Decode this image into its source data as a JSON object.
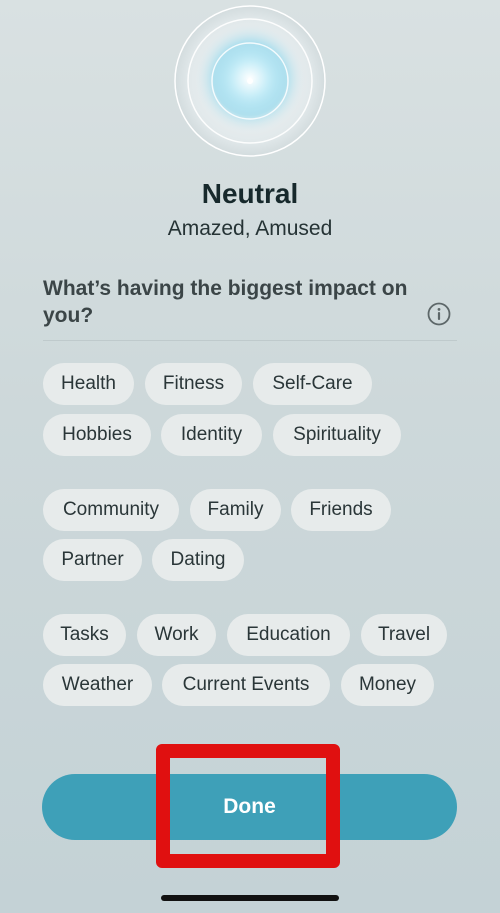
{
  "mood": {
    "title": "Neutral",
    "subtitle": "Amazed, Amused"
  },
  "question": "What’s having the biggest impact on you?",
  "info_icon": "info-circle-icon",
  "chip_groups": [
    [
      "Health",
      "Fitness",
      "Self-Care",
      "Hobbies",
      "Identity",
      "Spirituality"
    ],
    [
      "Community",
      "Family",
      "Friends",
      "Partner",
      "Dating"
    ],
    [
      "Tasks",
      "Work",
      "Education",
      "Travel",
      "Weather",
      "Current Events",
      "Money"
    ]
  ],
  "done_label": "Done",
  "colors": {
    "accent": "#3ea0b8",
    "chip_background": "#e7ebeb",
    "highlight": "#e01010"
  }
}
